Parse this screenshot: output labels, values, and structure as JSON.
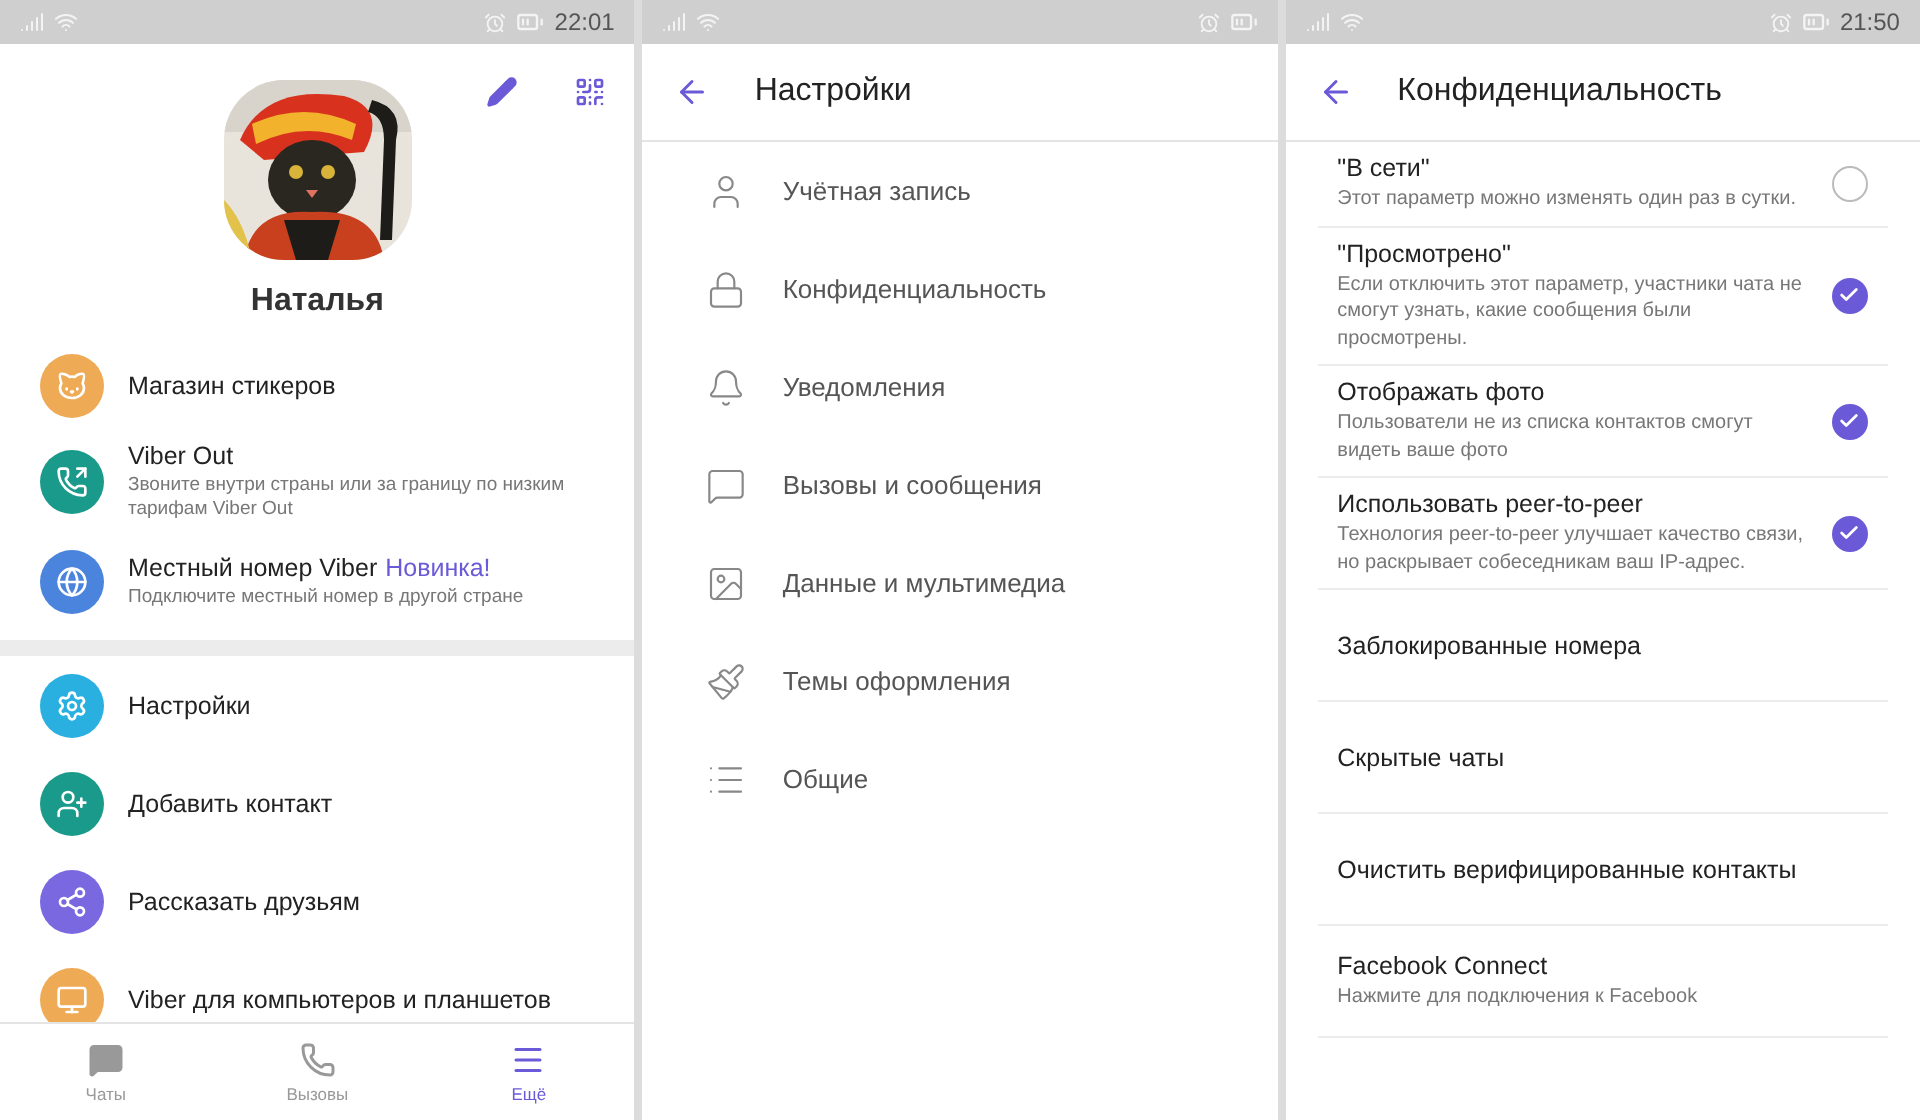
{
  "profile_screen": {
    "status_bar": {
      "time": "22:01"
    },
    "name": "Наталья",
    "menu_groups": [
      [
        {
          "title": "Магазин стикеров",
          "color": "#eeaa55"
        },
        {
          "title": "Viber Out",
          "subtitle": "Звоните внутри страны или за границу по низким тарифам Viber Out",
          "color": "#1a9a8a"
        },
        {
          "title": "Местный номер Viber",
          "badge": "Новинка!",
          "subtitle": "Подключите местный номер в другой стране",
          "color": "#4a84dc"
        }
      ],
      [
        {
          "title": "Настройки",
          "color": "#2ab0e0"
        },
        {
          "title": "Добавить контакт",
          "color": "#1a9a8a"
        },
        {
          "title": "Рассказать друзьям",
          "color": "#7a68e0"
        },
        {
          "title": "Viber для компьютеров и планшетов",
          "color": "#eeaa55"
        }
      ]
    ],
    "bottom_nav": [
      {
        "label": "Чаты",
        "selected": false
      },
      {
        "label": "Вызовы",
        "selected": false
      },
      {
        "label": "Ещё",
        "selected": true
      }
    ]
  },
  "settings_screen": {
    "title": "Настройки",
    "items": [
      "Учётная запись",
      "Конфиденциальность",
      "Уведомления",
      "Вызовы и сообщения",
      "Данные и мультимедиа",
      "Темы оформления",
      "Общие"
    ]
  },
  "privacy_screen": {
    "status_bar": {
      "time": "21:50"
    },
    "title": "Конфиденциальность",
    "items": [
      {
        "kind": "toggle",
        "title": "\"В сети\"",
        "subtitle": "Этот параметр можно изменять один раз в сутки.",
        "checked": false
      },
      {
        "kind": "toggle",
        "title": "\"Просмотрено\"",
        "subtitle": "Если отключить этот параметр, участники чата не смогут узнать, какие сообщения были просмотрены.",
        "checked": true
      },
      {
        "kind": "toggle",
        "title": "Отображать фото",
        "subtitle": "Пользователи не из списка контактов смогут видеть ваше фото",
        "checked": true
      },
      {
        "kind": "toggle",
        "title": "Использовать peer-to-peer",
        "subtitle": "Технология peer-to-peer улучшает качество связи, но раскрывает собеседникам ваш IP-адрес.",
        "checked": true
      },
      {
        "kind": "link",
        "title": "Заблокированные номера"
      },
      {
        "kind": "link",
        "title": "Скрытые чаты"
      },
      {
        "kind": "link",
        "title": "Очистить верифицированные контакты"
      },
      {
        "kind": "link",
        "title": "Facebook Connect",
        "subtitle": "Нажмите для подключения к Facebook"
      }
    ]
  }
}
